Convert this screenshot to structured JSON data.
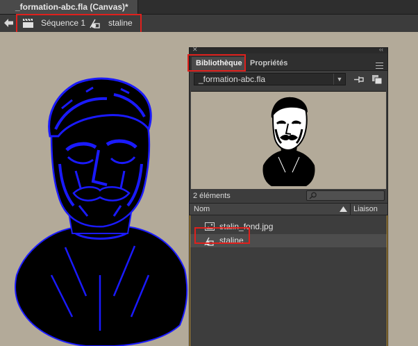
{
  "document_tab": {
    "title": "_formation-abc.fla (Canvas)*"
  },
  "edit_bar": {
    "scene_label": "Séquence 1",
    "symbol_label": "staline"
  },
  "library_panel": {
    "tabs": [
      {
        "label": "Bibliothèque",
        "active": true
      },
      {
        "label": "Propriétés",
        "active": false
      }
    ],
    "file_select": {
      "value": "_formation-abc.fla"
    },
    "item_count": "2 éléments",
    "search": {
      "placeholder": ""
    },
    "columns": {
      "name": "Nom",
      "linkage": "Liaison"
    },
    "items": [
      {
        "name": "stalin_fond.jpg",
        "type": "bitmap",
        "icon": "bitmap-icon"
      },
      {
        "name": "staline",
        "type": "graphic-symbol",
        "icon": "graphic-symbol-icon",
        "selected": true
      }
    ]
  },
  "colors": {
    "stage": "#b3aa99",
    "highlight_box": "#e0201c",
    "vector_selection": "#1a1aff",
    "panel_bg": "#3d3d3d",
    "focus_border": "#d4a030"
  }
}
